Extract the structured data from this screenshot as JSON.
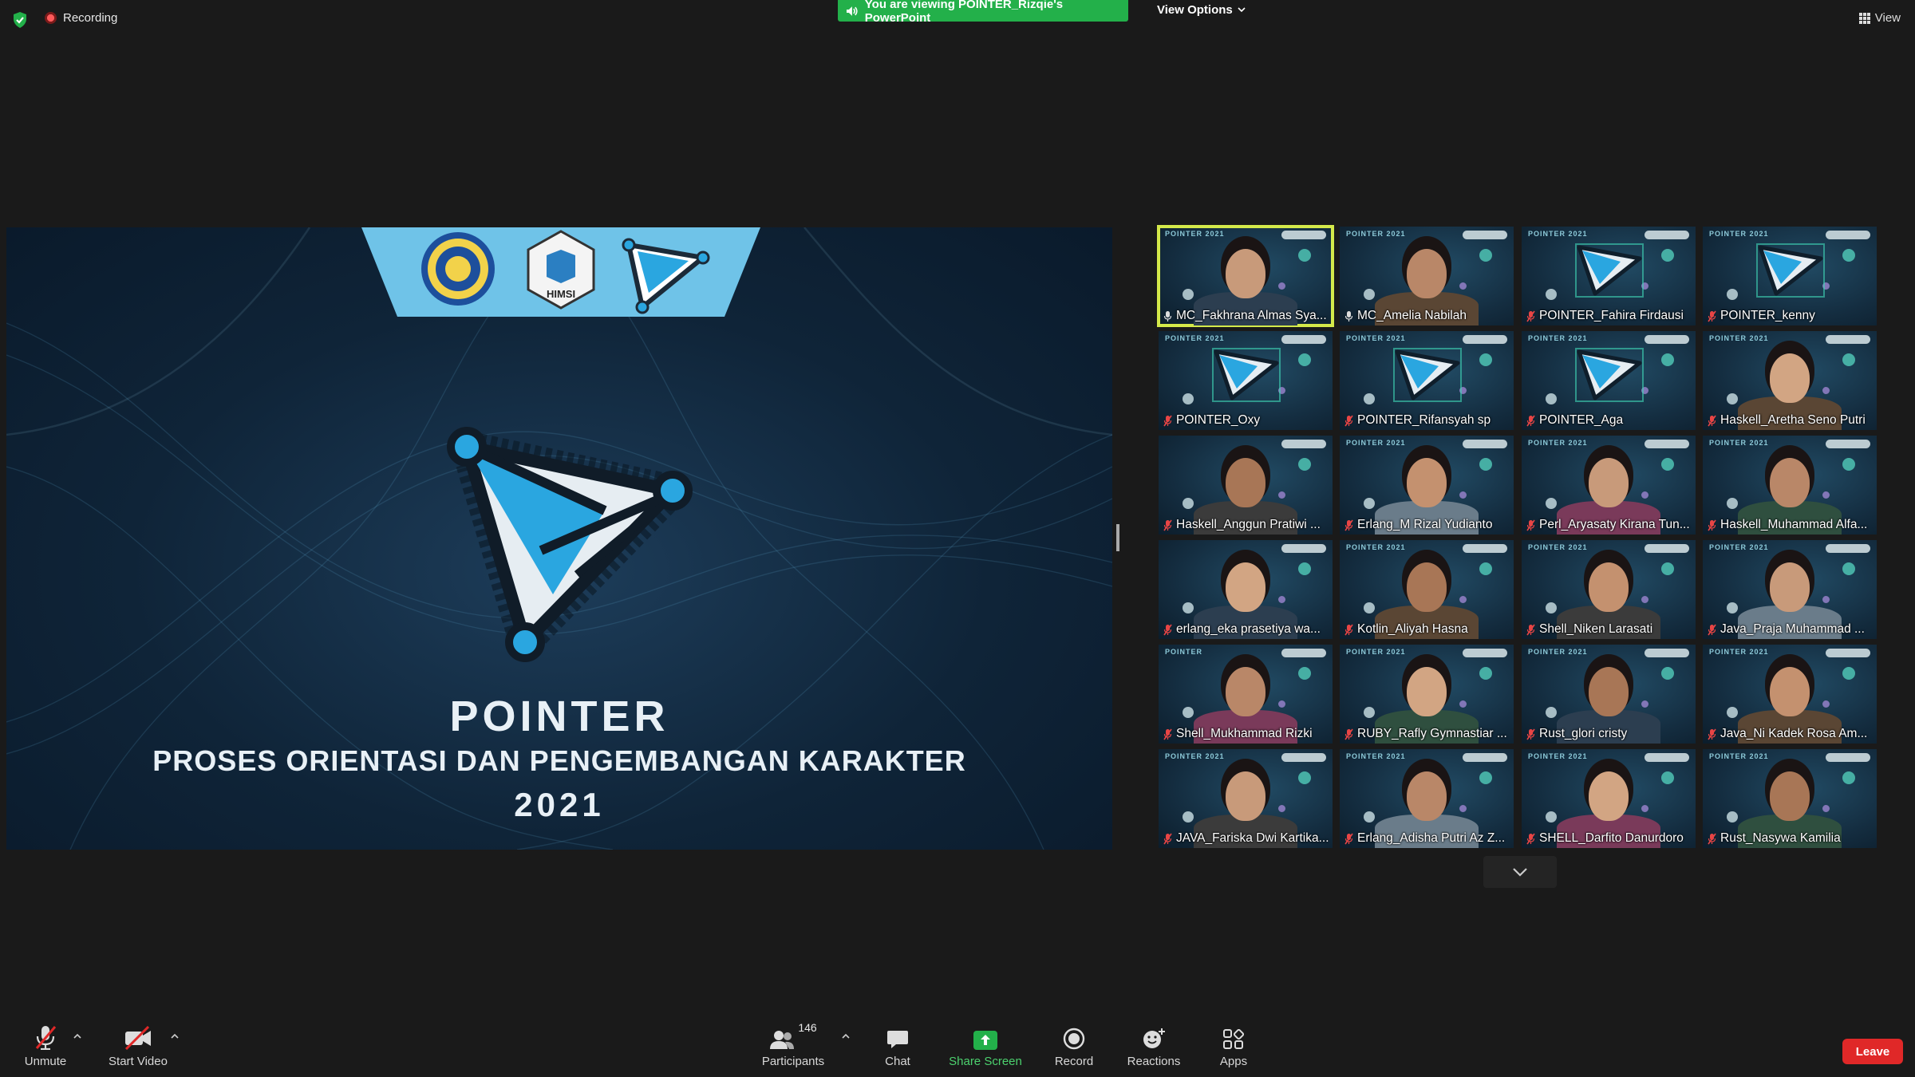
{
  "top_bar": {
    "recording_label": "Recording",
    "viewing_banner": "You are viewing POINTER_Rizqie's PowerPoint",
    "view_options_label": "View Options",
    "view_label": "View"
  },
  "slide": {
    "title": "POINTER",
    "subtitle": "PROSES ORIENTASI DAN PENGEMBANGAN KARAKTER",
    "year": "2021",
    "banner_logos": [
      "UNAIR",
      "HIMSI"
    ],
    "colors": {
      "accent": "#2aa6e0",
      "banner": "#6fc3e8",
      "background": "#0f2438"
    }
  },
  "gallery": {
    "tiles": [
      {
        "name": "MC_Fakhrana Almas Sya...",
        "tag": "POINTER 2021",
        "kind": "person",
        "active": true,
        "mic": "unmuted"
      },
      {
        "name": "MC_Amelia Nabilah",
        "tag": "POINTER 2021",
        "kind": "person",
        "active": false,
        "mic": "unmuted"
      },
      {
        "name": "POINTER_Fahira Firdausi",
        "tag": "POINTER 2021",
        "kind": "logo",
        "active": false,
        "mic": "muted"
      },
      {
        "name": "POINTER_kenny",
        "tag": "POINTER 2021",
        "kind": "logo",
        "active": false,
        "mic": "muted"
      },
      {
        "name": "POINTER_Oxy",
        "tag": "POINTER 2021",
        "kind": "logo",
        "active": false,
        "mic": "muted"
      },
      {
        "name": "POINTER_Rifansyah sp",
        "tag": "POINTER 2021",
        "kind": "logo",
        "active": false,
        "mic": "muted"
      },
      {
        "name": "POINTER_Aga",
        "tag": "POINTER 2021",
        "kind": "logo",
        "active": false,
        "mic": "muted"
      },
      {
        "name": "Haskell_Aretha Seno Putri",
        "tag": "POINTER 2021",
        "kind": "person",
        "active": false,
        "mic": "muted"
      },
      {
        "name": "Haskell_Anggun Pratiwi ...",
        "tag": "",
        "kind": "person",
        "active": false,
        "mic": "muted"
      },
      {
        "name": "Erlang_M Rizal Yudianto",
        "tag": "POINTER 2021",
        "kind": "person",
        "active": false,
        "mic": "muted"
      },
      {
        "name": "Perl_Aryasaty Kirana Tun...",
        "tag": "POINTER 2021",
        "kind": "person",
        "active": false,
        "mic": "muted"
      },
      {
        "name": "Haskell_Muhammad Alfa...",
        "tag": "POINTER 2021",
        "kind": "person",
        "active": false,
        "mic": "muted"
      },
      {
        "name": "erlang_eka prasetiya wa...",
        "tag": "",
        "kind": "person",
        "active": false,
        "mic": "muted"
      },
      {
        "name": "Kotlin_Aliyah Hasna",
        "tag": "POINTER 2021",
        "kind": "person",
        "active": false,
        "mic": "muted"
      },
      {
        "name": "Shell_Niken Larasati",
        "tag": "POINTER 2021",
        "kind": "person",
        "active": false,
        "mic": "muted"
      },
      {
        "name": "Java_Praja Muhammad ...",
        "tag": "POINTER 2021",
        "kind": "person",
        "active": false,
        "mic": "muted"
      },
      {
        "name": "Shell_Mukhammad Rizki",
        "tag": "POINTER",
        "kind": "person",
        "active": false,
        "mic": "muted"
      },
      {
        "name": "RUBY_Rafly Gymnastiar ...",
        "tag": "POINTER 2021",
        "kind": "person",
        "active": false,
        "mic": "muted"
      },
      {
        "name": "Rust_glori cristy",
        "tag": "POINTER 2021",
        "kind": "person",
        "active": false,
        "mic": "muted"
      },
      {
        "name": "Java_Ni Kadek Rosa Am...",
        "tag": "POINTER 2021",
        "kind": "person",
        "active": false,
        "mic": "muted"
      },
      {
        "name": "JAVA_Fariska Dwi Kartika...",
        "tag": "POINTER 2021",
        "kind": "person",
        "active": false,
        "mic": "muted"
      },
      {
        "name": "Erlang_Adisha Putri Az Z...",
        "tag": "POINTER 2021",
        "kind": "person",
        "active": false,
        "mic": "muted"
      },
      {
        "name": "SHELL_Darfito Danurdoro",
        "tag": "POINTER 2021",
        "kind": "person",
        "active": false,
        "mic": "muted"
      },
      {
        "name": "Rust_Nasywa Kamilia",
        "tag": "POINTER 2021",
        "kind": "person",
        "active": false,
        "mic": "muted"
      }
    ]
  },
  "toolbar": {
    "unmute_label": "Unmute",
    "start_video_label": "Start Video",
    "participants_label": "Participants",
    "participants_count": "146",
    "chat_label": "Chat",
    "share_screen_label": "Share Screen",
    "record_label": "Record",
    "reactions_label": "Reactions",
    "apps_label": "Apps",
    "leave_label": "Leave",
    "colors": {
      "share": "#23b04a",
      "leave": "#e02828",
      "muted": "#e02828"
    }
  }
}
